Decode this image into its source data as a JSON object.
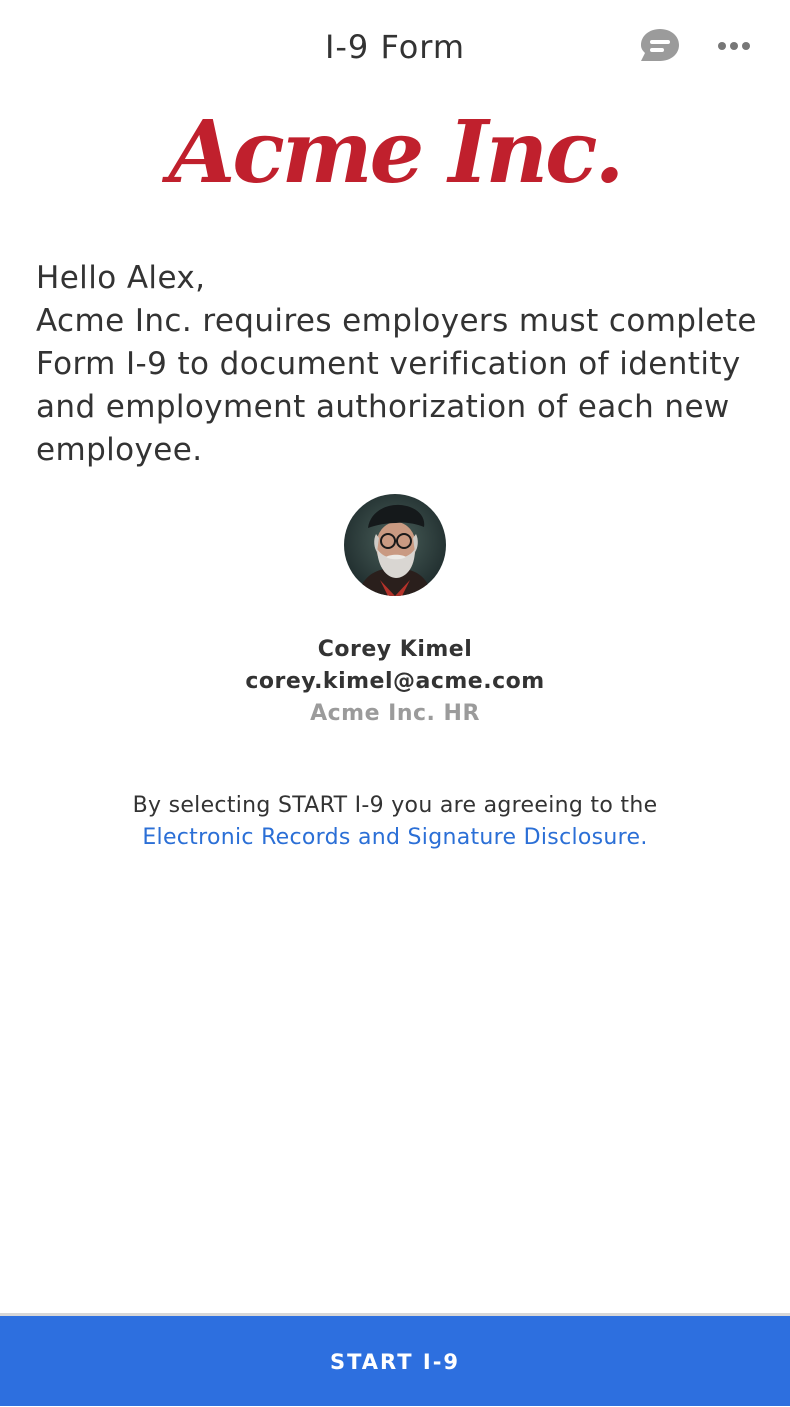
{
  "header": {
    "title": "I-9 Form",
    "chat_icon": "chat-bubble-icon",
    "more_icon": "more-dots-icon",
    "icon_color": "#9b9b9b"
  },
  "logo": {
    "text": "Acme Inc.",
    "color": "#c0202d"
  },
  "intro": {
    "greeting": "Hello Alex,",
    "body": "Acme Inc. requires employers must complete Form I-9 to document verification of identity and employment authorization of each new employee."
  },
  "sender": {
    "avatar_icon": "avatar",
    "name": "Corey Kimel",
    "email": "corey.kimel@acme.com",
    "role": "Acme Inc. HR"
  },
  "disclosure": {
    "text": "By selecting START I-9 you are agreeing to the",
    "link": "Electronic Records and Signature Disclosure.",
    "link_color": "#2b6fd6"
  },
  "footer": {
    "start_label": "START I-9",
    "button_color": "#2d6fdf"
  }
}
